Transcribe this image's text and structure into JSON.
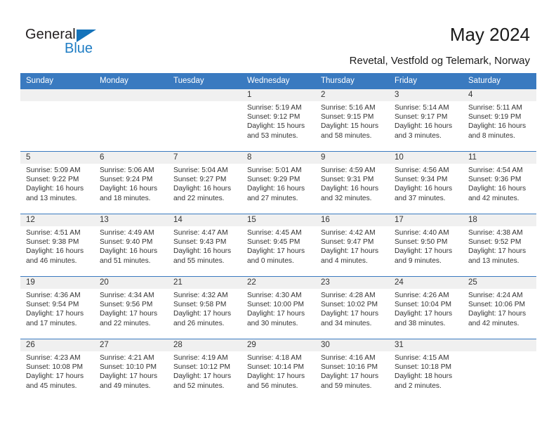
{
  "brand": {
    "name_top": "General",
    "name_bottom": "Blue",
    "triangle_color": "#1573ba",
    "blue_color": "#1f7dc4"
  },
  "header": {
    "title": "May 2024",
    "subtitle": "Revetal, Vestfold og Telemark, Norway",
    "accent_color": "#3a7ac0"
  },
  "calendar": {
    "weekdays": [
      "Sunday",
      "Monday",
      "Tuesday",
      "Wednesday",
      "Thursday",
      "Friday",
      "Saturday"
    ],
    "labels": {
      "sunrise": "Sunrise:",
      "sunset": "Sunset:",
      "daylight": "Daylight:"
    },
    "weeks": [
      [
        {
          "day": "",
          "sunrise": "",
          "sunset": "",
          "daylight": ""
        },
        {
          "day": "",
          "sunrise": "",
          "sunset": "",
          "daylight": ""
        },
        {
          "day": "",
          "sunrise": "",
          "sunset": "",
          "daylight": ""
        },
        {
          "day": "1",
          "sunrise": "Sunrise: 5:19 AM",
          "sunset": "Sunset: 9:12 PM",
          "daylight": "Daylight: 15 hours and 53 minutes."
        },
        {
          "day": "2",
          "sunrise": "Sunrise: 5:16 AM",
          "sunset": "Sunset: 9:15 PM",
          "daylight": "Daylight: 15 hours and 58 minutes."
        },
        {
          "day": "3",
          "sunrise": "Sunrise: 5:14 AM",
          "sunset": "Sunset: 9:17 PM",
          "daylight": "Daylight: 16 hours and 3 minutes."
        },
        {
          "day": "4",
          "sunrise": "Sunrise: 5:11 AM",
          "sunset": "Sunset: 9:19 PM",
          "daylight": "Daylight: 16 hours and 8 minutes."
        }
      ],
      [
        {
          "day": "5",
          "sunrise": "Sunrise: 5:09 AM",
          "sunset": "Sunset: 9:22 PM",
          "daylight": "Daylight: 16 hours and 13 minutes."
        },
        {
          "day": "6",
          "sunrise": "Sunrise: 5:06 AM",
          "sunset": "Sunset: 9:24 PM",
          "daylight": "Daylight: 16 hours and 18 minutes."
        },
        {
          "day": "7",
          "sunrise": "Sunrise: 5:04 AM",
          "sunset": "Sunset: 9:27 PM",
          "daylight": "Daylight: 16 hours and 22 minutes."
        },
        {
          "day": "8",
          "sunrise": "Sunrise: 5:01 AM",
          "sunset": "Sunset: 9:29 PM",
          "daylight": "Daylight: 16 hours and 27 minutes."
        },
        {
          "day": "9",
          "sunrise": "Sunrise: 4:59 AM",
          "sunset": "Sunset: 9:31 PM",
          "daylight": "Daylight: 16 hours and 32 minutes."
        },
        {
          "day": "10",
          "sunrise": "Sunrise: 4:56 AM",
          "sunset": "Sunset: 9:34 PM",
          "daylight": "Daylight: 16 hours and 37 minutes."
        },
        {
          "day": "11",
          "sunrise": "Sunrise: 4:54 AM",
          "sunset": "Sunset: 9:36 PM",
          "daylight": "Daylight: 16 hours and 42 minutes."
        }
      ],
      [
        {
          "day": "12",
          "sunrise": "Sunrise: 4:51 AM",
          "sunset": "Sunset: 9:38 PM",
          "daylight": "Daylight: 16 hours and 46 minutes."
        },
        {
          "day": "13",
          "sunrise": "Sunrise: 4:49 AM",
          "sunset": "Sunset: 9:40 PM",
          "daylight": "Daylight: 16 hours and 51 minutes."
        },
        {
          "day": "14",
          "sunrise": "Sunrise: 4:47 AM",
          "sunset": "Sunset: 9:43 PM",
          "daylight": "Daylight: 16 hours and 55 minutes."
        },
        {
          "day": "15",
          "sunrise": "Sunrise: 4:45 AM",
          "sunset": "Sunset: 9:45 PM",
          "daylight": "Daylight: 17 hours and 0 minutes."
        },
        {
          "day": "16",
          "sunrise": "Sunrise: 4:42 AM",
          "sunset": "Sunset: 9:47 PM",
          "daylight": "Daylight: 17 hours and 4 minutes."
        },
        {
          "day": "17",
          "sunrise": "Sunrise: 4:40 AM",
          "sunset": "Sunset: 9:50 PM",
          "daylight": "Daylight: 17 hours and 9 minutes."
        },
        {
          "day": "18",
          "sunrise": "Sunrise: 4:38 AM",
          "sunset": "Sunset: 9:52 PM",
          "daylight": "Daylight: 17 hours and 13 minutes."
        }
      ],
      [
        {
          "day": "19",
          "sunrise": "Sunrise: 4:36 AM",
          "sunset": "Sunset: 9:54 PM",
          "daylight": "Daylight: 17 hours and 17 minutes."
        },
        {
          "day": "20",
          "sunrise": "Sunrise: 4:34 AM",
          "sunset": "Sunset: 9:56 PM",
          "daylight": "Daylight: 17 hours and 22 minutes."
        },
        {
          "day": "21",
          "sunrise": "Sunrise: 4:32 AM",
          "sunset": "Sunset: 9:58 PM",
          "daylight": "Daylight: 17 hours and 26 minutes."
        },
        {
          "day": "22",
          "sunrise": "Sunrise: 4:30 AM",
          "sunset": "Sunset: 10:00 PM",
          "daylight": "Daylight: 17 hours and 30 minutes."
        },
        {
          "day": "23",
          "sunrise": "Sunrise: 4:28 AM",
          "sunset": "Sunset: 10:02 PM",
          "daylight": "Daylight: 17 hours and 34 minutes."
        },
        {
          "day": "24",
          "sunrise": "Sunrise: 4:26 AM",
          "sunset": "Sunset: 10:04 PM",
          "daylight": "Daylight: 17 hours and 38 minutes."
        },
        {
          "day": "25",
          "sunrise": "Sunrise: 4:24 AM",
          "sunset": "Sunset: 10:06 PM",
          "daylight": "Daylight: 17 hours and 42 minutes."
        }
      ],
      [
        {
          "day": "26",
          "sunrise": "Sunrise: 4:23 AM",
          "sunset": "Sunset: 10:08 PM",
          "daylight": "Daylight: 17 hours and 45 minutes."
        },
        {
          "day": "27",
          "sunrise": "Sunrise: 4:21 AM",
          "sunset": "Sunset: 10:10 PM",
          "daylight": "Daylight: 17 hours and 49 minutes."
        },
        {
          "day": "28",
          "sunrise": "Sunrise: 4:19 AM",
          "sunset": "Sunset: 10:12 PM",
          "daylight": "Daylight: 17 hours and 52 minutes."
        },
        {
          "day": "29",
          "sunrise": "Sunrise: 4:18 AM",
          "sunset": "Sunset: 10:14 PM",
          "daylight": "Daylight: 17 hours and 56 minutes."
        },
        {
          "day": "30",
          "sunrise": "Sunrise: 4:16 AM",
          "sunset": "Sunset: 10:16 PM",
          "daylight": "Daylight: 17 hours and 59 minutes."
        },
        {
          "day": "31",
          "sunrise": "Sunrise: 4:15 AM",
          "sunset": "Sunset: 10:18 PM",
          "daylight": "Daylight: 18 hours and 2 minutes."
        },
        {
          "day": "",
          "sunrise": "",
          "sunset": "",
          "daylight": ""
        }
      ]
    ]
  }
}
